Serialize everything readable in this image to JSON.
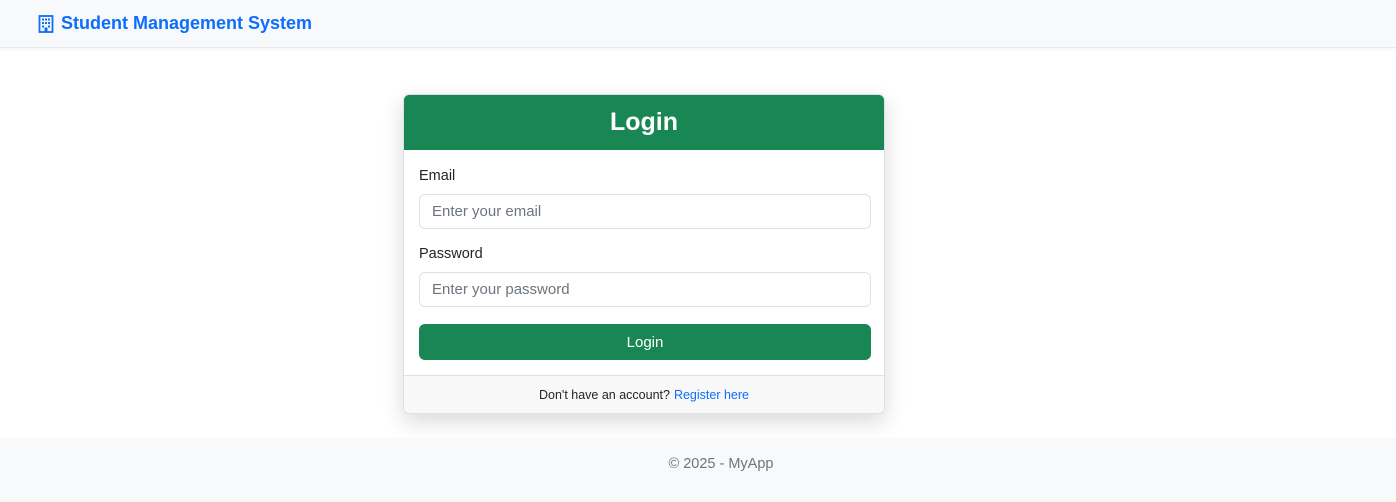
{
  "navbar": {
    "brand_icon": "building-icon",
    "brand_text": "Student Management System",
    "brand_color": "#0d6efd"
  },
  "login_card": {
    "title": "Login",
    "header_color": "#198754",
    "email_label": "Email",
    "email_placeholder": "Enter your email",
    "email_value": "",
    "password_label": "Password",
    "password_placeholder": "Enter your password",
    "password_value": "",
    "submit_label": "Login",
    "footer_text": "Don't have an account?",
    "register_link": "Register here"
  },
  "footer": {
    "copyright": "© 2025 - MyApp"
  }
}
